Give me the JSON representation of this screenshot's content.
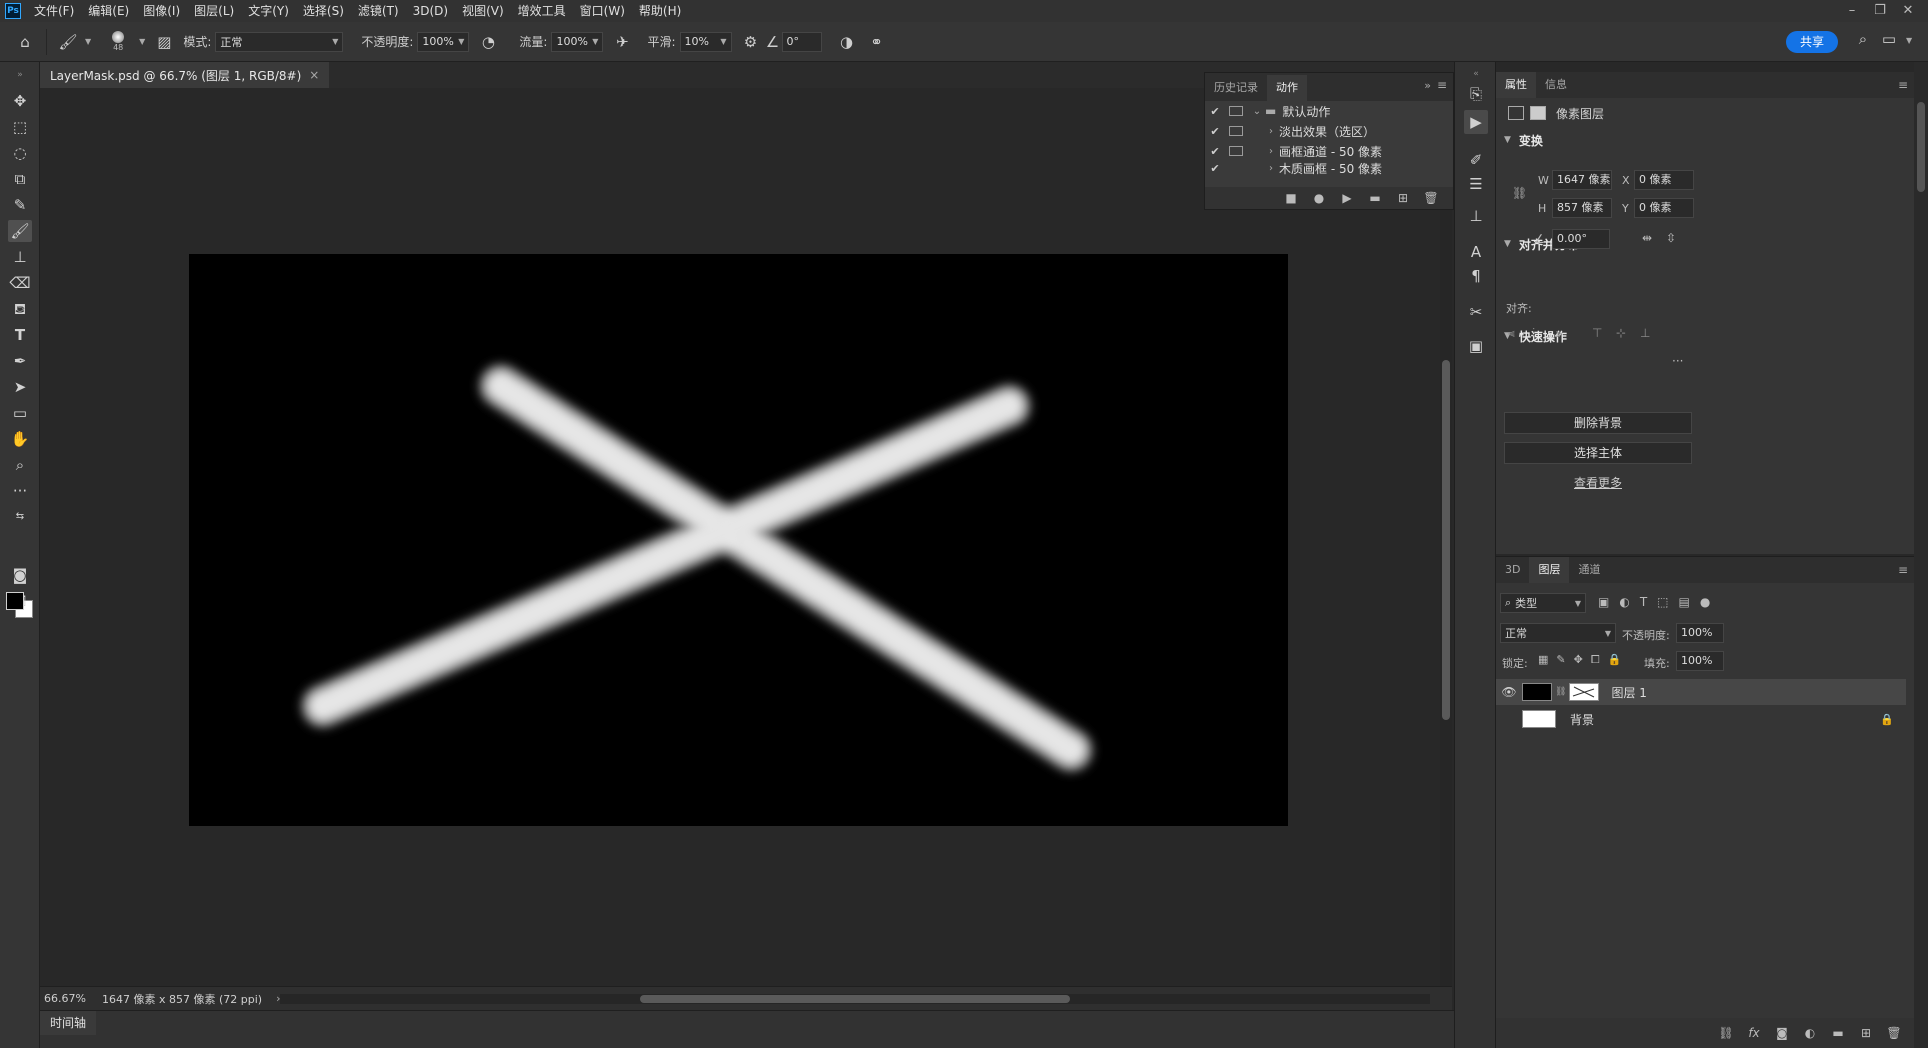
{
  "app": {
    "logo": "Ps"
  },
  "menu": [
    "文件(F)",
    "编辑(E)",
    "图像(I)",
    "图层(L)",
    "文字(Y)",
    "选择(S)",
    "滤镜(T)",
    "3D(D)",
    "视图(V)",
    "增效工具",
    "窗口(W)",
    "帮助(H)"
  ],
  "options": {
    "brush_size": "48",
    "mode_label": "模式:",
    "mode_value": "正常",
    "opacity_label": "不透明度:",
    "opacity_value": "100%",
    "flow_label": "流量:",
    "flow_value": "100%",
    "smooth_label": "平滑:",
    "smooth_value": "10%",
    "angle_value": "0°",
    "share_label": "共享"
  },
  "document": {
    "tab_title": "LayerMask.psd @ 66.7% (图层 1, RGB/8#)",
    "zoom": "66.67%",
    "info": "1647 像素 x 857 像素 (72 ppi)"
  },
  "timeline": {
    "tab": "时间轴"
  },
  "actions_panel": {
    "tabs": [
      "历史记录",
      "动作"
    ],
    "rows": [
      {
        "label": "默认动作"
      },
      {
        "label": "淡出效果（选区）"
      },
      {
        "label": "画框通道 - 50 像素"
      },
      {
        "label": "木质画框 - 50 像素"
      }
    ]
  },
  "properties": {
    "tabs": [
      "属性",
      "信息"
    ],
    "layer_type": "像素图层",
    "transform_title": "变换",
    "w_label": "W",
    "w_value": "1647 像素",
    "h_label": "H",
    "h_value": "857 像素",
    "x_label": "X",
    "x_value": "0 像素",
    "y_label": "Y",
    "y_value": "0 像素",
    "angle_value": "0.00°",
    "align_title": "对齐并分布",
    "align_label": "对齐:",
    "more": "···",
    "quick_title": "快速操作",
    "remove_bg": "删除背景",
    "select_subject": "选择主体",
    "see_more": "查看更多"
  },
  "layers": {
    "tabs": [
      "3D",
      "图层",
      "通道"
    ],
    "filter_kind": "类型",
    "blend_mode": "正常",
    "opacity_label": "不透明度:",
    "opacity_value": "100%",
    "lock_label": "锁定:",
    "fill_label": "填充:",
    "fill_value": "100%",
    "items": [
      {
        "name": "图层 1"
      },
      {
        "name": "背景"
      }
    ]
  },
  "colors": {
    "foreground": "#000000",
    "background": "#ffffff",
    "accent": "#1473e6"
  }
}
